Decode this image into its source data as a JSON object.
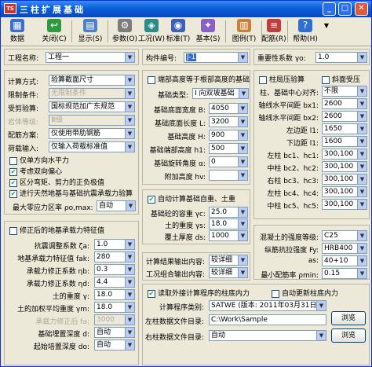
{
  "window": {
    "title": "三柱扩展基础",
    "app_badge": "TS"
  },
  "toolbar": {
    "items": [
      {
        "label": "数据",
        "icon": "save-icon"
      },
      {
        "label": "关闭(C)",
        "icon": "close-icon"
      },
      {
        "label": "显示(S)",
        "icon": "display-icon"
      },
      {
        "label": "参数(O)",
        "icon": "params-icon"
      },
      {
        "label": "工况(W)",
        "icon": "loadcase-icon"
      },
      {
        "label": "标准(T)",
        "icon": "standard-icon"
      },
      {
        "label": "基本(S)",
        "icon": "basic-icon"
      },
      {
        "label": "图例(T)",
        "icon": "legend-icon"
      },
      {
        "label": "配筋(R)",
        "icon": "rebar-icon"
      },
      {
        "label": "帮助(H)",
        "icon": "help-icon"
      }
    ]
  },
  "left": {
    "project_name": {
      "label": "工程名称:",
      "value": "工程一"
    },
    "calc_method": {
      "label": "计算方式:",
      "value": "验算截面尺寸"
    },
    "limit_condition": {
      "label": "限制条件:",
      "value": "无限制条件"
    },
    "standard": {
      "label": "受剪验算:",
      "value": "国标规范加广东规范"
    },
    "rock_strength": {
      "label": "岩体等级:",
      "value": "Ⅲ级"
    },
    "rebar_method": {
      "label": "配筋方案:",
      "value": "仅使用带肋钢筋"
    },
    "load_input": {
      "label": "荷载输入:",
      "value": "仅输入荷载标准值"
    },
    "checks": [
      {
        "label": "仅单方向水平力",
        "checked": false
      },
      {
        "label": "考虑双向偏心",
        "checked": true
      },
      {
        "label": "区分弯矩、剪力的正负极值",
        "checked": true
      },
      {
        "label": "进行天然地基与基础抗震承载力验算",
        "checked": true
      }
    ],
    "min_zero_ratio": {
      "label": "最大零应力区率 ρo,max:",
      "value": "自动"
    },
    "foundation_group_title": "修正后的地基承载力特征值",
    "foundation_rows": [
      {
        "label": "抗震调整系数 ζa:",
        "value": "1.0"
      },
      {
        "label": "地基承载力特征值 fak:",
        "value": "280"
      },
      {
        "label": "承载力修正系数 ηb:",
        "value": "0.3"
      },
      {
        "label": "承载力修正系数 ηd:",
        "value": "4.4"
      },
      {
        "label": "土的重度 γ:",
        "value": "18.0"
      },
      {
        "label": "土的加权平均重度 γm:",
        "value": "18.0"
      },
      {
        "label": "承载力修正后 fa:",
        "value": "3000"
      },
      {
        "label": "基础埋置深度 d:",
        "value": "自动"
      },
      {
        "label": "起始培置深度 do:",
        "value": "自动"
      }
    ]
  },
  "middle": {
    "member_number": {
      "label": "构件编号:",
      "value": "J-1"
    },
    "top_check": "端部高度等于根部高度的基础",
    "fields": [
      {
        "label": "基础类型:",
        "value": "Ⅰ 向双坡基础"
      },
      {
        "label": "基础底面宽度 B:",
        "value": "4050"
      },
      {
        "label": "基础底面长度 L:",
        "value": "3200"
      },
      {
        "label": "基础高度 H:",
        "value": "900"
      },
      {
        "label": "基础端部高度 h1:",
        "value": "500"
      },
      {
        "label": "基础旋转角度 α:",
        "value": "0"
      },
      {
        "label": "附加高度 hv:",
        "value": ""
      }
    ],
    "auto_weight": "自动计算基础自重、土重",
    "weight_rows": [
      {
        "label": "基础砼的容重 γc:",
        "value": "25.0"
      },
      {
        "label": "土的重度 γs:",
        "value": "18.0"
      },
      {
        "label": "覆土厚度 ds:",
        "value": "1000"
      }
    ],
    "output_content": {
      "label": "计算结果输出内容:",
      "value": "较详细"
    },
    "loadcase_output": {
      "label": "工况组合输出内容:",
      "value": "较详细"
    },
    "read_external": "读取外接计算程序的柱底内力",
    "auto_update": "自动更新柱底内力",
    "program": {
      "label": "计算程序类别:",
      "value": "SATWE (版本: 2011年03月31日)"
    },
    "left_file": {
      "label": "左柱数据文件目录:",
      "value": "C:\\Work\\Sample"
    },
    "right_file": {
      "label": "右柱数据文件目录:",
      "value": "自动"
    },
    "browse": "浏览"
  },
  "right": {
    "importance": {
      "label": "重要性系数 γo:",
      "value": "1.0"
    },
    "col_axial": "柱局压验算",
    "col_bevel": "斜面受压",
    "rows": [
      {
        "label": "柱、基础中心对齐:",
        "value": "不限"
      },
      {
        "label": "轴线水平间距 bx1:",
        "value": "2600"
      },
      {
        "label": "轴线水平间距 bx2:",
        "value": "2600"
      },
      {
        "label": "左边距 l1:",
        "value": "1650"
      },
      {
        "label": "下边距 l1:",
        "value": "1600"
      },
      {
        "label": "左柱 bc1、hc1:",
        "value": "300,100"
      },
      {
        "label": "中柱 bc2、hc2:",
        "value": "300,100"
      },
      {
        "label": "右柱 bc3、hc3:",
        "value": "300,100"
      },
      {
        "label": "左柱 bc4、hc4:",
        "value": "300,100"
      },
      {
        "label": "中柱 bc5、hc5:",
        "value": "300,100"
      }
    ],
    "concrete_grade": {
      "label": "混凝土的强度等级:",
      "value": "C25"
    },
    "rebar_grade": {
      "label": "纵筋抗拉强度 Fy:",
      "value": "HRB400"
    },
    "cover": {
      "label": "as:",
      "value": "40+10"
    },
    "min_ratio": {
      "label": "最小配筋率 ρmin:",
      "value": "0.15"
    }
  }
}
